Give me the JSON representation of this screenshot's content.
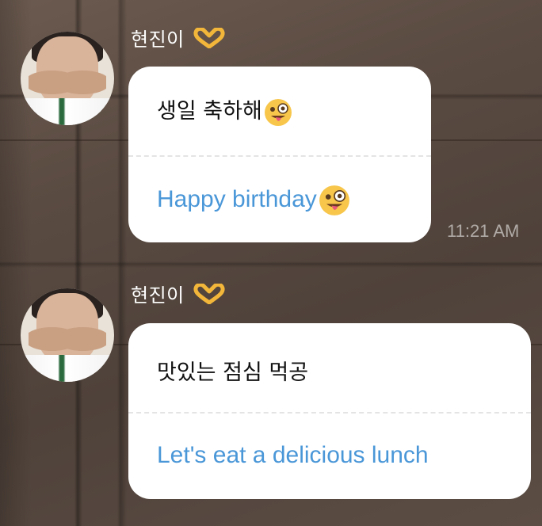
{
  "messages": [
    {
      "sender_name": "현진이",
      "sender_badge_icon": "heart-hands-icon",
      "original_text": "생일 축하해",
      "original_emoji": "winking-face-with-tongue-icon",
      "translated_text": "Happy birthday",
      "translated_emoji": "winking-face-with-tongue-icon",
      "timestamp": "11:21 AM"
    },
    {
      "sender_name": "현진이",
      "sender_badge_icon": "heart-hands-icon",
      "original_text": "맛있는 점심 먹공",
      "translated_text": "Let's eat a delicious lunch"
    }
  ],
  "colors": {
    "translation_text": "#4a97d8",
    "bubble_bg": "#ffffff",
    "name_text": "#ffffff",
    "timestamp_text": "#bdb6b1"
  }
}
